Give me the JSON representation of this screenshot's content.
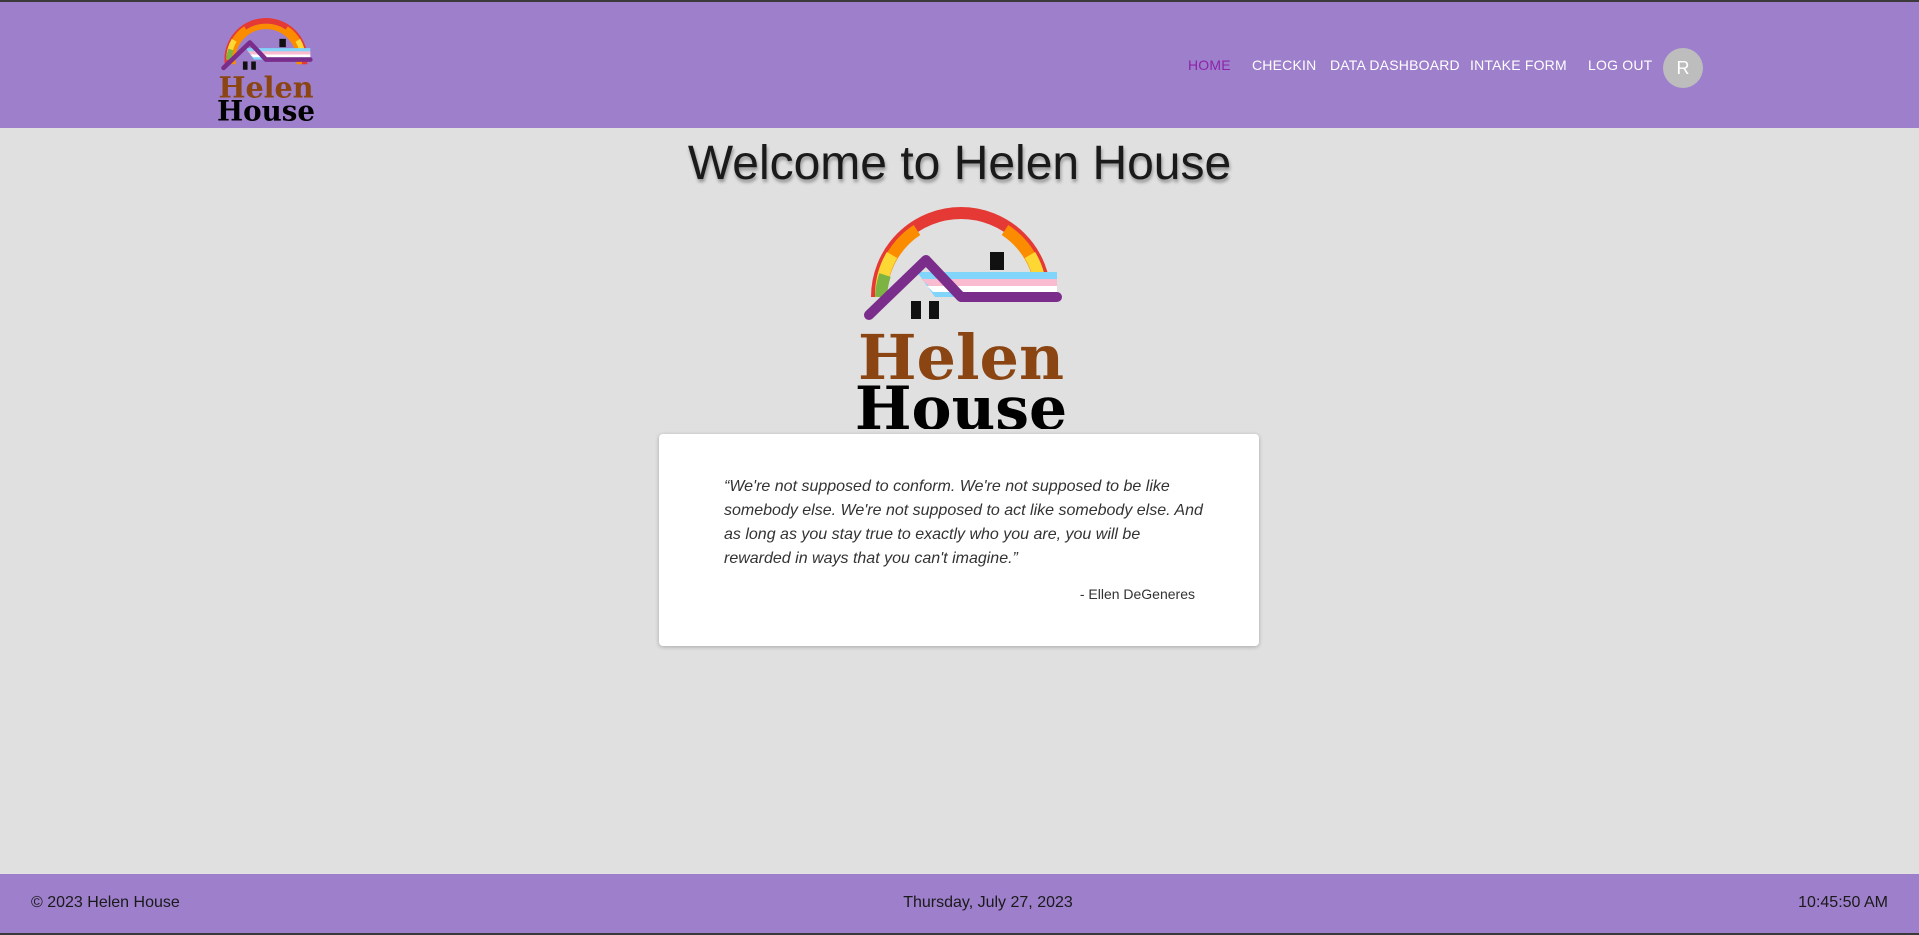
{
  "header": {
    "logo": {
      "line1": "Helen",
      "line2": "House"
    },
    "nav": {
      "home": "HOME",
      "checkin": "CHECKIN",
      "dashboard": "DATA DASHBOARD",
      "intake": "INTAKE FORM",
      "logout": "LOG OUT"
    },
    "avatar_initial": "R"
  },
  "main": {
    "title": "Welcome to Helen House",
    "logo": {
      "line1": "Helen",
      "line2": "House"
    },
    "quote": {
      "text": "“We're not supposed to conform. We're not supposed to be like somebody else. We're not supposed to act like somebody else. And as long as you stay true to exactly who you are, you will be rewarded in ways that you can't imagine.”",
      "author": "- Ellen DeGeneres"
    }
  },
  "footer": {
    "copyright": "© 2023 Helen House",
    "date": "Thursday, July 27, 2023",
    "time": "10:45:50 AM"
  },
  "colors": {
    "brand_purple": "#9d7fcb",
    "active_nav": "#8e24aa",
    "background": "#e0e0e0",
    "house_roof": "#7b2d8b",
    "helen_text": "#8b4513"
  },
  "icons": {
    "logo": "helen-house-logo-icon",
    "avatar": "avatar-circle"
  }
}
